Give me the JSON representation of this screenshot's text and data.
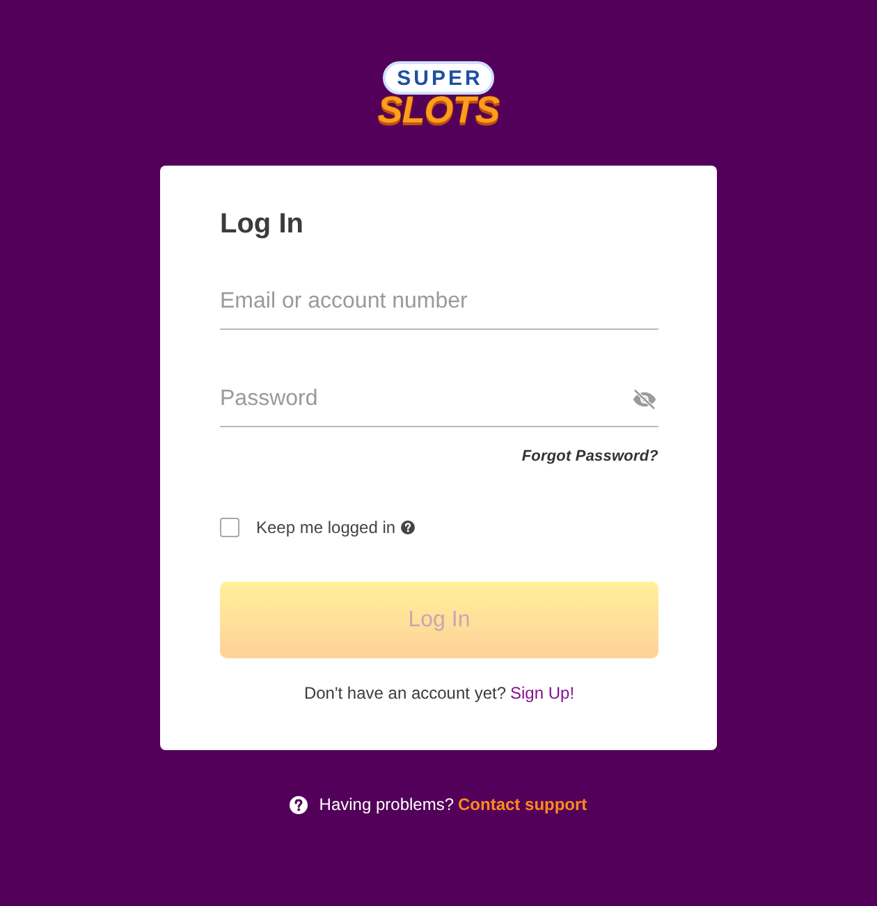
{
  "logo": {
    "line_1": "SUPER",
    "line_2": "SLOTS"
  },
  "login_card": {
    "title": "Log In",
    "fields": [
      {
        "kind": "email",
        "placeholder": "Email or account number"
      },
      {
        "kind": "password",
        "placeholder": "Password"
      }
    ],
    "forgot_link": "Forgot Password?",
    "remember": {
      "label": "Keep me logged in",
      "checked": false
    },
    "submit": {
      "label": "Log In",
      "disabled": true
    },
    "signup": {
      "text": "Don't have an account yet?",
      "link": "Sign Up!"
    }
  },
  "help": {
    "text": "Having problems?",
    "link": "Contact support"
  }
}
